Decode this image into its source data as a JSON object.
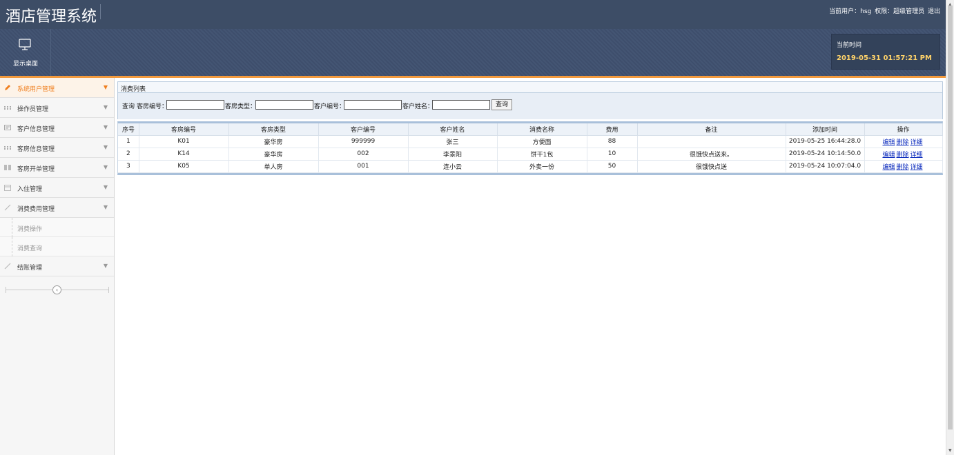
{
  "app": {
    "title": "酒店管理系统",
    "user_text": "当前用户：hsg",
    "role_text": "权限：超级管理员",
    "logout_label": "退出"
  },
  "toolbar": {
    "desktop_label": "显示桌面",
    "time_title": "当前时间",
    "time_value": "2019-05-31 01:57:21 PM",
    "desktop_icon": "monitor-icon"
  },
  "sidebar": {
    "items": [
      {
        "label": "系统用户管理",
        "icon": "pencil-icon",
        "active": true
      },
      {
        "label": "操作员管理",
        "icon": "grid-icon"
      },
      {
        "label": "客户信息管理",
        "icon": "card-icon"
      },
      {
        "label": "客房信息管理",
        "icon": "grid-icon"
      },
      {
        "label": "客房开单管理",
        "icon": "columns-icon"
      },
      {
        "label": "入住管理",
        "icon": "calendar-icon"
      },
      {
        "label": "消费费用管理",
        "icon": "brush-icon"
      },
      {
        "label": "结账管理",
        "icon": "brush-icon"
      }
    ],
    "sub_items": [
      "消费操作",
      "消费查询"
    ],
    "collapse_icon": "chevron-left-icon"
  },
  "panel": {
    "title": "消费列表",
    "search": {
      "prefix": "查询",
      "room_no_label": "客房编号：",
      "room_type_label": "客房类型：",
      "customer_no_label": "客户编号：",
      "customer_name_label": "客户姓名：",
      "room_no_value": "",
      "room_type_value": "",
      "customer_no_value": "",
      "customer_name_value": "",
      "button_label": "查询"
    }
  },
  "table": {
    "headers": [
      "序号",
      "客房编号",
      "客房类型",
      "客户编号",
      "客户姓名",
      "消费名称",
      "费用",
      "备注",
      "添加时间",
      "操作"
    ],
    "rows": [
      [
        "1",
        "K01",
        "豪华房",
        "999999",
        "张三",
        "方便面",
        "88",
        "",
        "2019-05-25 16:44:28.0"
      ],
      [
        "2",
        "K14",
        "豪华房",
        "002",
        "李景阳",
        "饼干1包",
        "10",
        "很饿快点送来。",
        "2019-05-24 10:14:50.0"
      ],
      [
        "3",
        "K05",
        "单人房",
        "001",
        "连小云",
        "外卖一份",
        "50",
        "很饿快点送",
        "2019-05-24 10:07:04.0"
      ]
    ],
    "actions": [
      "编辑",
      "删除",
      "详细"
    ]
  },
  "colors": {
    "header_bg": "#3d4d66",
    "accent_orange": "#f39a3d",
    "time_yellow": "#ffd36a",
    "link_blue": "#0b2bbd"
  }
}
